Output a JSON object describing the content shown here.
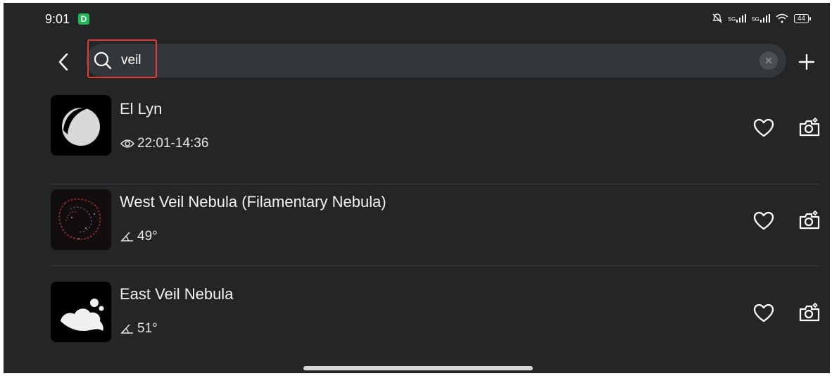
{
  "status_bar": {
    "time": "9:01",
    "app_badge": "D",
    "network": "5G",
    "network2": "5G",
    "battery": "44"
  },
  "search": {
    "value": "veil",
    "placeholder": ""
  },
  "results": [
    {
      "title": "El Lyn",
      "meta": "22:01-14:36",
      "meta_icon": "eye-icon",
      "thumb": "moon-thumbnail"
    },
    {
      "title": "West Veil Nebula (Filamentary Nebula)",
      "meta": "49°",
      "meta_icon": "altitude-angle-icon",
      "thumb": "nebula-photo-thumbnail"
    },
    {
      "title": "East Veil Nebula",
      "meta": "51°",
      "meta_icon": "altitude-angle-icon",
      "thumb": "nebula-cloud-thumbnail"
    }
  ],
  "colors": {
    "background": "#232527",
    "search_bg": "#34373a",
    "accent": "#1db954",
    "highlight": "#e03b36"
  }
}
